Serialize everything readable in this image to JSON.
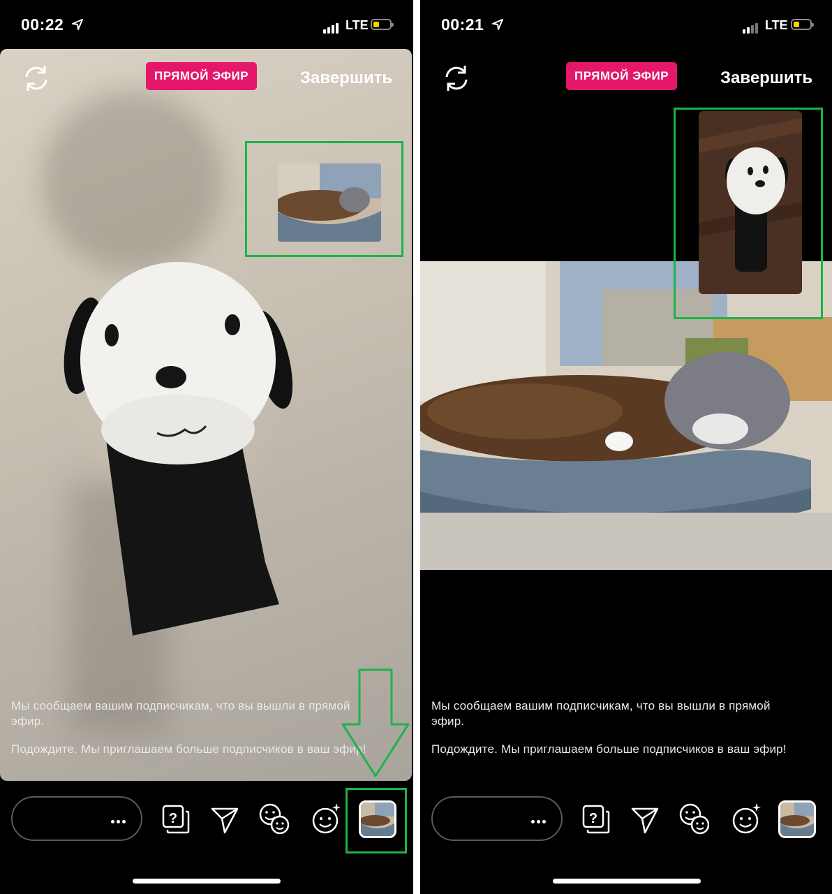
{
  "status_left": {
    "time": "00:22",
    "network": "LTE"
  },
  "status_right": {
    "time": "00:21",
    "network": "LTE"
  },
  "live_badge": "ПРЯМОЙ ЭФИР",
  "end_button": "Завершить",
  "notice": {
    "line1": "Мы сообщаем вашим подписчикам, что вы вышли в прямой эфир.",
    "line2": "Подождите. Мы приглашаем больше подписчиков в ваш эфир!"
  },
  "colors": {
    "live_badge": "#e4176a",
    "highlight": "#1db34a",
    "background": "#000000"
  },
  "icons": [
    "location-arrow-icon",
    "signal-icon",
    "battery-icon",
    "flip-camera-icon",
    "question-sticker-icon",
    "send-icon",
    "add-guest-icon",
    "effects-icon",
    "more-icon",
    "arrow-down-icon"
  ]
}
